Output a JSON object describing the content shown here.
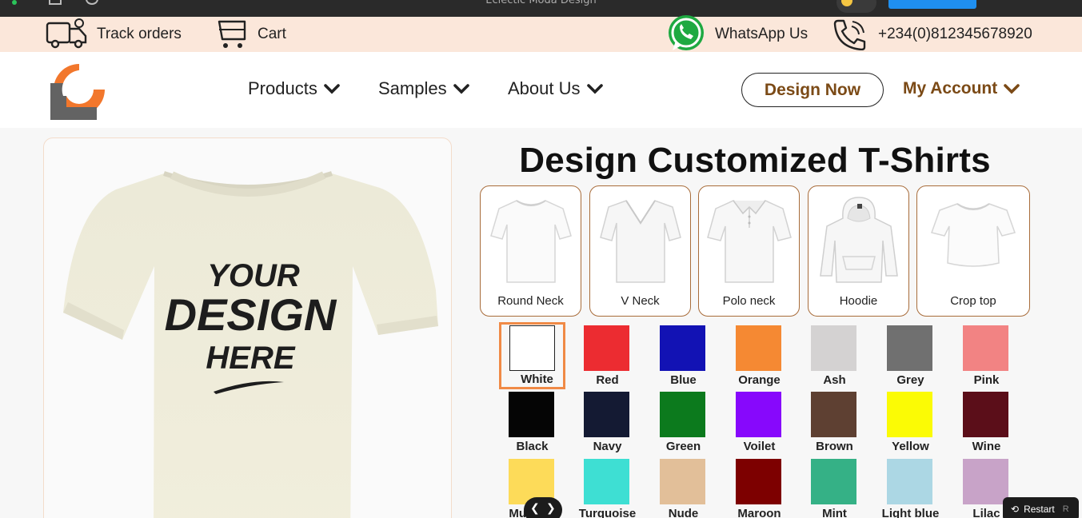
{
  "window": {
    "title": "Eclectic Moda Design"
  },
  "infobar": {
    "track_orders": "Track orders",
    "cart": "Cart",
    "whatsapp": "WhatsApp Us",
    "phone": "+234(0)812345678920"
  },
  "nav": {
    "products": "Products",
    "samples": "Samples",
    "about": "About Us",
    "design_now": "Design Now",
    "my_account": "My Account"
  },
  "preview": {
    "line1": "YOUR",
    "line2": "DESIGN",
    "line3": "HERE"
  },
  "main": {
    "heading": "Design Customized T-Shirts",
    "styles": [
      "Round Neck",
      "V Neck",
      "Polo neck",
      "Hoodie",
      "Crop top"
    ],
    "colors": [
      {
        "name": "White",
        "hex": "#ffffff",
        "selected": true
      },
      {
        "name": "Red",
        "hex": "#ec2c31"
      },
      {
        "name": "Blue",
        "hex": "#1212b4"
      },
      {
        "name": "Orange",
        "hex": "#f58933"
      },
      {
        "name": "Ash",
        "hex": "#d4d2d2"
      },
      {
        "name": "Grey",
        "hex": "#707070"
      },
      {
        "name": "Pink",
        "hex": "#f28383"
      },
      {
        "name": "Black",
        "hex": "#050505"
      },
      {
        "name": "Navy",
        "hex": "#141a33"
      },
      {
        "name": "Green",
        "hex": "#0c7a1d"
      },
      {
        "name": "Voilet",
        "hex": "#8708fc"
      },
      {
        "name": "Brown",
        "hex": "#5e4032"
      },
      {
        "name": "Yellow",
        "hex": "#fbfb05"
      },
      {
        "name": "Wine",
        "hex": "#5b0e19"
      },
      {
        "name": "Mustard",
        "hex": "#fddb59"
      },
      {
        "name": "Turquoise",
        "hex": "#3edfd3"
      },
      {
        "name": "Nude",
        "hex": "#e2bf99"
      },
      {
        "name": "Maroon",
        "hex": "#7d0000"
      },
      {
        "name": "Mint",
        "hex": "#35b186"
      },
      {
        "name": "Light blue",
        "hex": "#acd7e4"
      },
      {
        "name": "Lilac",
        "hex": "#c8a3c8"
      }
    ]
  },
  "overlay": {
    "restart": "Restart",
    "restart_key": "R"
  },
  "colors": {
    "accent": "#7b4a16",
    "selected_border": "#f08a46",
    "infobar_bg": "#fbe7da"
  }
}
